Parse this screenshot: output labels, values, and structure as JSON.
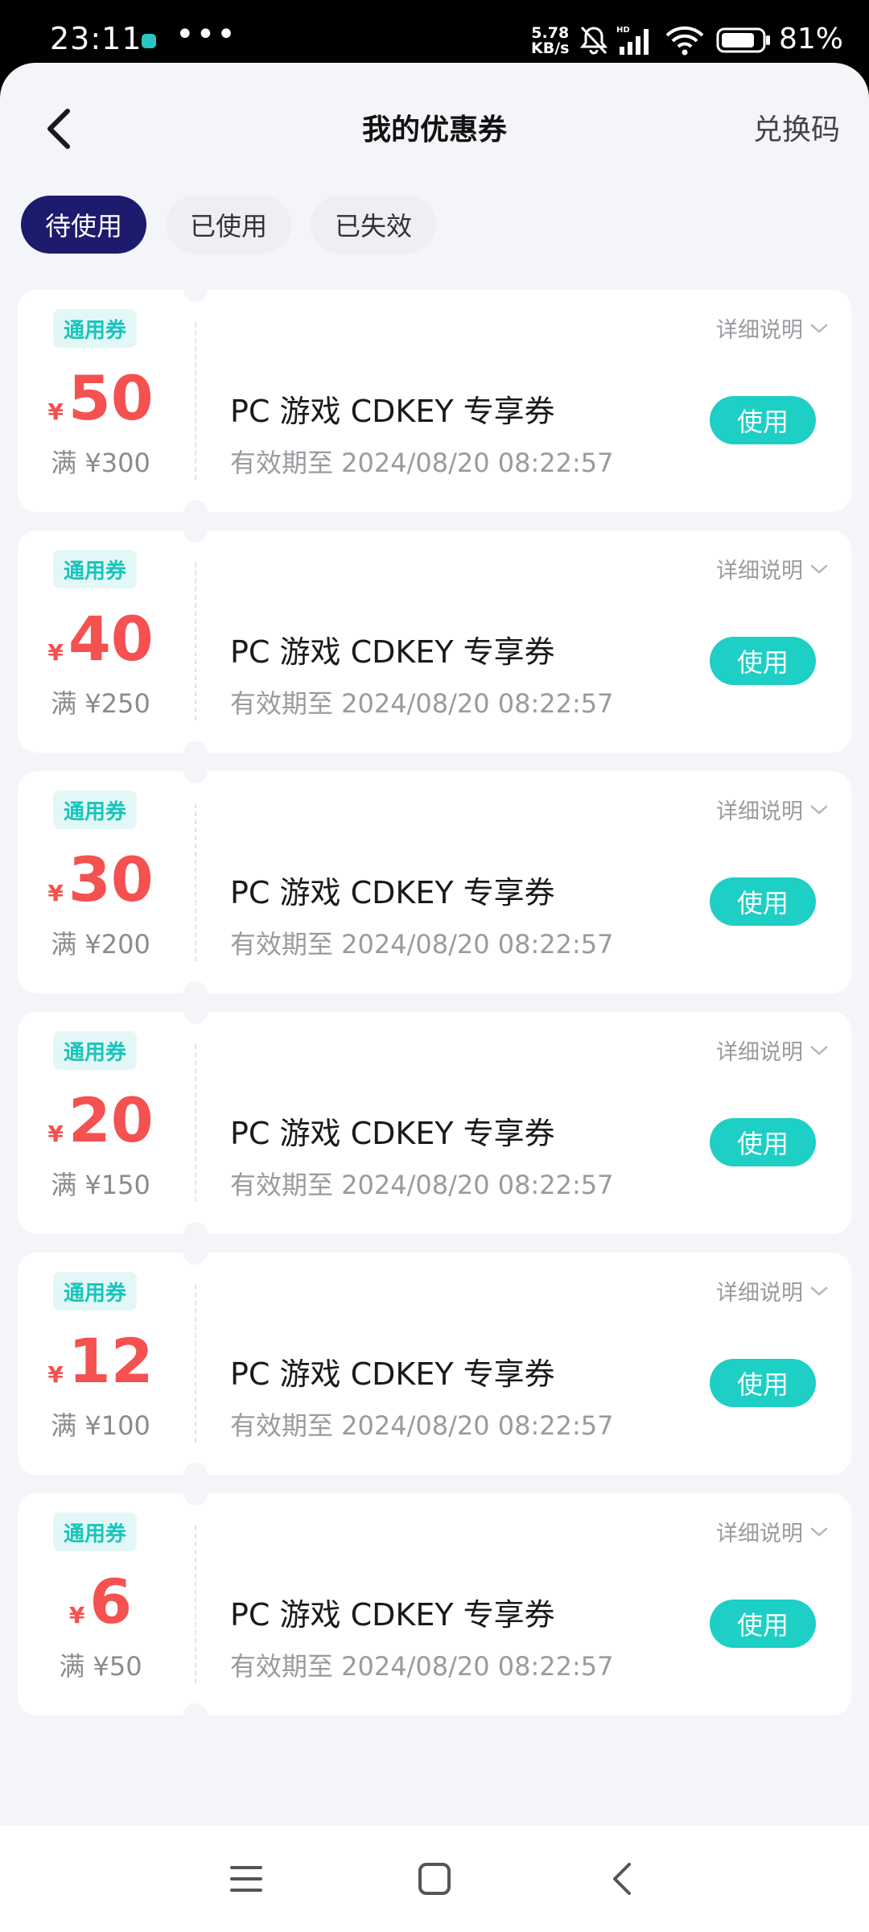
{
  "status_bar": {
    "time": "23:11",
    "dots": "•••",
    "speed_value": "5.78",
    "speed_unit": "KB/s",
    "battery": "81%"
  },
  "nav": {
    "title": "我的优惠券",
    "redeem_label": "兑换码"
  },
  "tabs": [
    {
      "label": "待使用",
      "active": true
    },
    {
      "label": "已使用",
      "active": false
    },
    {
      "label": "已失效",
      "active": false
    }
  ],
  "coupons": [
    {
      "badge": "通用券",
      "currency": "¥",
      "amount": "50",
      "min": "满 ¥300",
      "details": "详细说明",
      "title": "PC 游戏 CDKEY 专享券",
      "expiry": "有效期至 2024/08/20 08:22:57",
      "button": "使用"
    },
    {
      "badge": "通用券",
      "currency": "¥",
      "amount": "40",
      "min": "满 ¥250",
      "details": "详细说明",
      "title": "PC 游戏 CDKEY 专享券",
      "expiry": "有效期至 2024/08/20 08:22:57",
      "button": "使用"
    },
    {
      "badge": "通用券",
      "currency": "¥",
      "amount": "30",
      "min": "满 ¥200",
      "details": "详细说明",
      "title": "PC 游戏 CDKEY 专享券",
      "expiry": "有效期至 2024/08/20 08:22:57",
      "button": "使用"
    },
    {
      "badge": "通用券",
      "currency": "¥",
      "amount": "20",
      "min": "满 ¥150",
      "details": "详细说明",
      "title": "PC 游戏 CDKEY 专享券",
      "expiry": "有效期至 2024/08/20 08:22:57",
      "button": "使用"
    },
    {
      "badge": "通用券",
      "currency": "¥",
      "amount": "12",
      "min": "满 ¥100",
      "details": "详细说明",
      "title": "PC 游戏 CDKEY 专享券",
      "expiry": "有效期至 2024/08/20 08:22:57",
      "button": "使用"
    },
    {
      "badge": "通用券",
      "currency": "¥",
      "amount": "6",
      "min": "满 ¥50",
      "details": "详细说明",
      "title": "PC 游戏 CDKEY 专享券",
      "expiry": "有效期至 2024/08/20 08:22:57",
      "button": "使用"
    }
  ],
  "colors": {
    "active_tab": "#1c1b6d",
    "accent_teal": "#1dcfc4",
    "amount_red": "#f45150",
    "page_bg": "#f4f5f9"
  },
  "icons": {
    "back": "chevron-left-icon",
    "details": "chevron-down-icon",
    "menu": "menu-icon",
    "home": "home-square-icon",
    "sys_back": "back-arrow-icon"
  }
}
